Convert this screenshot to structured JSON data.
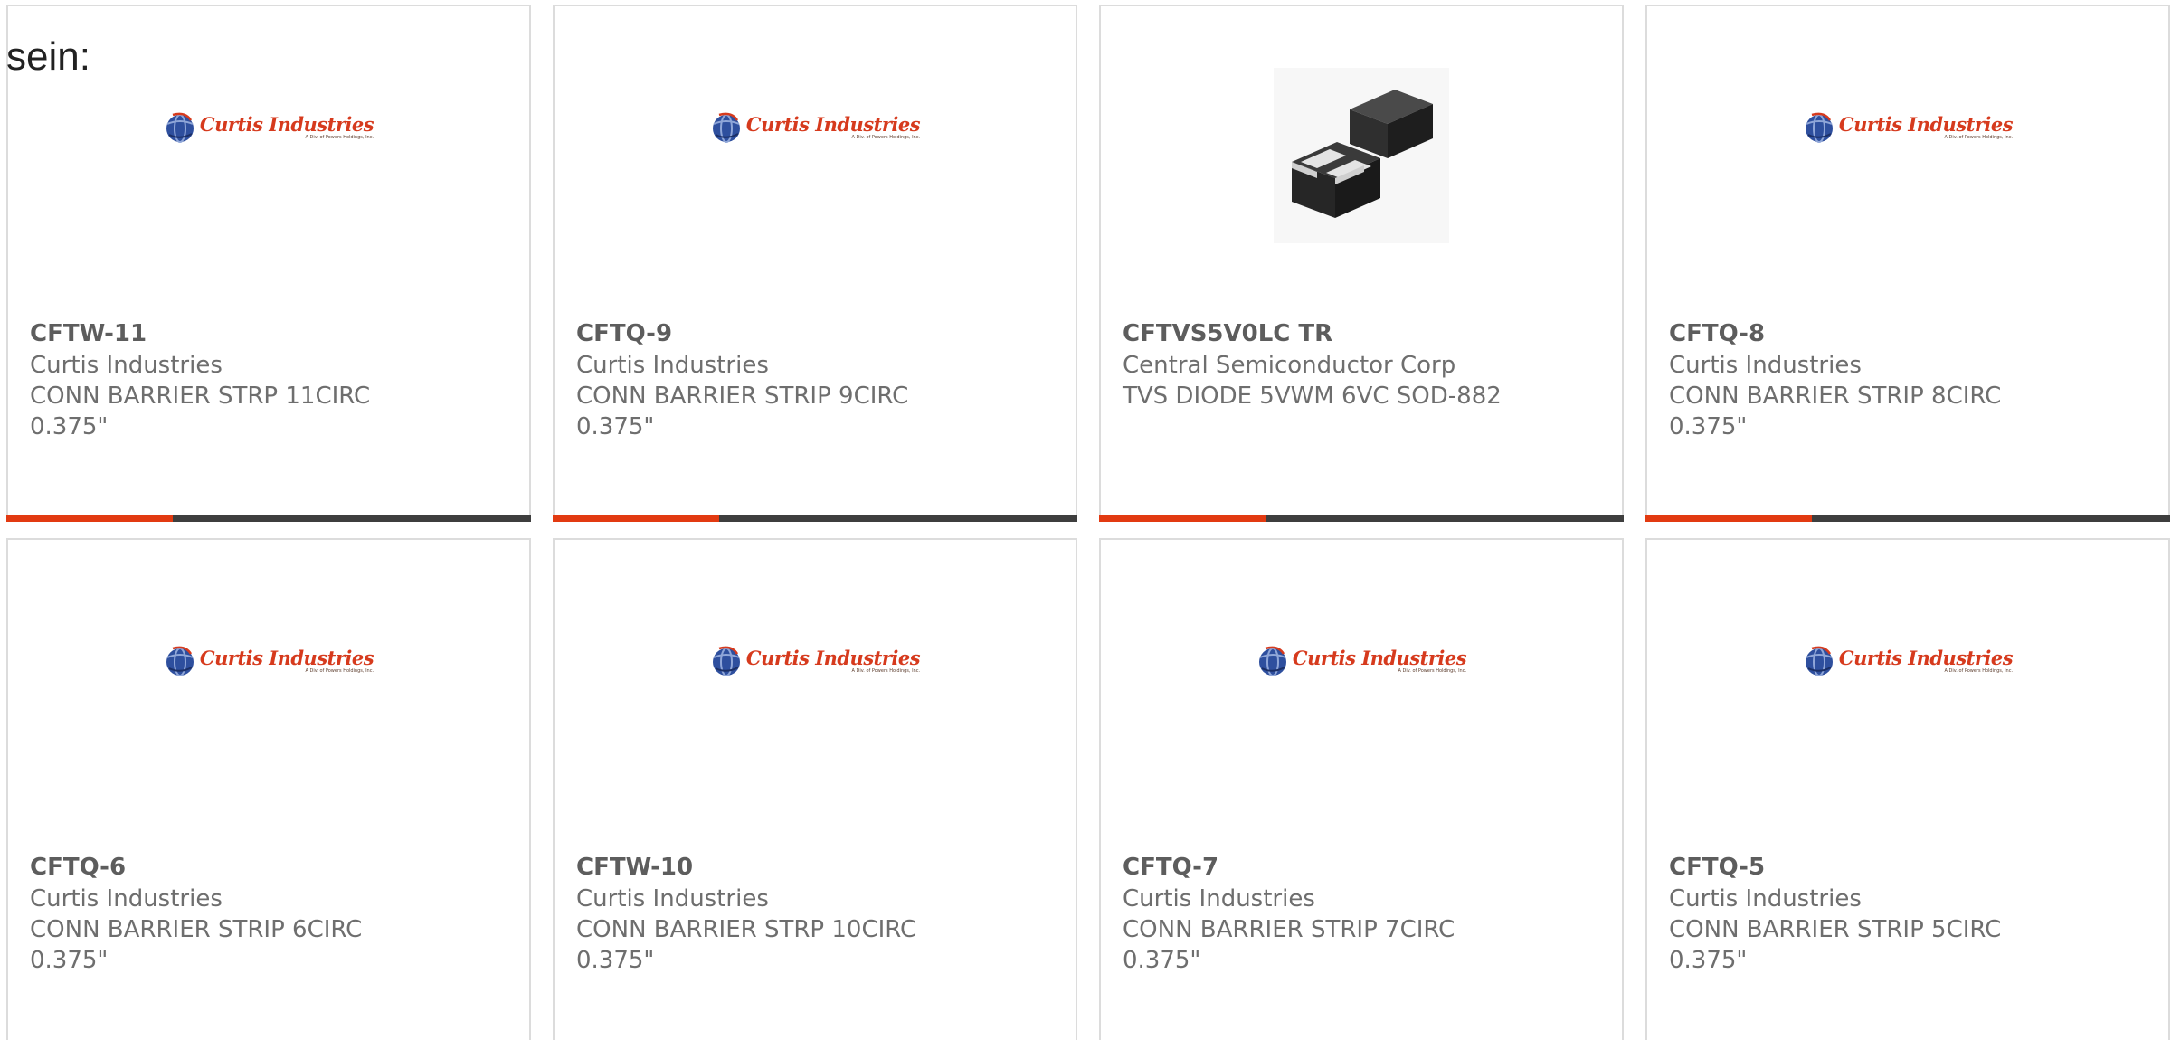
{
  "page": {
    "lead_text": "sein:"
  },
  "colors": {
    "accent": "#e23a11",
    "bar_dark": "#3e3e3e",
    "logo_red": "#d63a1d",
    "logo_blue": "#2e4f9e",
    "card_border": "#dcdcdc",
    "text_gray": "#6e6e6e"
  },
  "logo": {
    "name": "Curtis Industries",
    "sub": "A Div. of Powers Holdings, Inc."
  },
  "products": [
    {
      "part_number": "CFTW-11",
      "manufacturer": "Curtis Industries",
      "description": "CONN BARRIER STRP 11CIRC",
      "spec": "0.375\"",
      "image": "curtis-industries-logo",
      "bar_visible": true
    },
    {
      "part_number": "CFTQ-9",
      "manufacturer": "Curtis Industries",
      "description": "CONN BARRIER STRIP 9CIRC",
      "spec": "0.375\"",
      "image": "curtis-industries-logo",
      "bar_visible": true
    },
    {
      "part_number": "CFTVS5V0LC TR",
      "manufacturer": "Central Semiconductor Corp",
      "description": "TVS DIODE 5VWM 6VC SOD-882",
      "spec": "",
      "image": "sod-882-chip-photo",
      "bar_visible": true
    },
    {
      "part_number": "CFTQ-8",
      "manufacturer": "Curtis Industries",
      "description": "CONN BARRIER STRIP 8CIRC",
      "spec": "0.375\"",
      "image": "curtis-industries-logo",
      "bar_visible": true
    },
    {
      "part_number": "CFTQ-6",
      "manufacturer": "Curtis Industries",
      "description": "CONN BARRIER STRIP 6CIRC",
      "spec": "0.375\"",
      "image": "curtis-industries-logo",
      "bar_visible": false
    },
    {
      "part_number": "CFTW-10",
      "manufacturer": "Curtis Industries",
      "description": "CONN BARRIER STRP 10CIRC",
      "spec": "0.375\"",
      "image": "curtis-industries-logo",
      "bar_visible": false
    },
    {
      "part_number": "CFTQ-7",
      "manufacturer": "Curtis Industries",
      "description": "CONN BARRIER STRIP 7CIRC",
      "spec": "0.375\"",
      "image": "curtis-industries-logo",
      "bar_visible": false
    },
    {
      "part_number": "CFTQ-5",
      "manufacturer": "Curtis Industries",
      "description": "CONN BARRIER STRIP 5CIRC",
      "spec": "0.375\"",
      "image": "curtis-industries-logo",
      "bar_visible": false
    }
  ]
}
